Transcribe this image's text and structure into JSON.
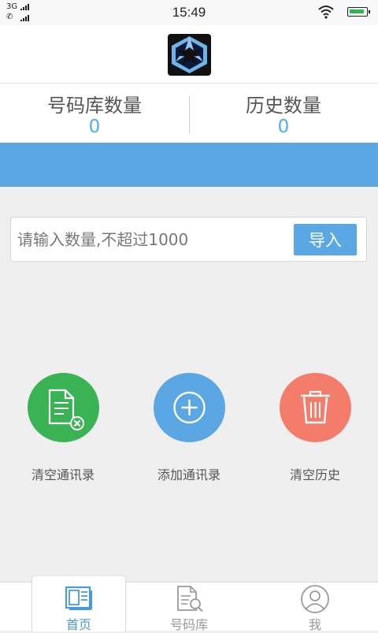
{
  "status_bar": {
    "sim1": "3G",
    "sim2": "📞",
    "time": "15:49",
    "icons": [
      "signal-icon",
      "wifi-icon",
      "battery-icon"
    ]
  },
  "stats": {
    "library_label": "号码库数量",
    "library_value": "0",
    "history_label": "历史数量",
    "history_value": "0"
  },
  "import": {
    "placeholder": "请输入数量,不超过1000",
    "button_label": "导入"
  },
  "actions": [
    {
      "label": "清空通讯录",
      "icon": "clear-contacts-icon",
      "color": "#3ab354"
    },
    {
      "label": "添加通讯录",
      "icon": "add-icon",
      "color": "#5aa7e3"
    },
    {
      "label": "清空历史",
      "icon": "trash-icon",
      "color": "#f47c6a"
    }
  ],
  "nav": [
    {
      "label": "首页",
      "icon": "home-icon",
      "active": true
    },
    {
      "label": "号码库",
      "icon": "number-library-icon",
      "active": false
    },
    {
      "label": "我",
      "icon": "profile-icon",
      "active": false
    }
  ],
  "colors": {
    "accent": "#5aa7e3",
    "green": "#3ab354",
    "red": "#f47c6a",
    "background": "#efefef"
  }
}
